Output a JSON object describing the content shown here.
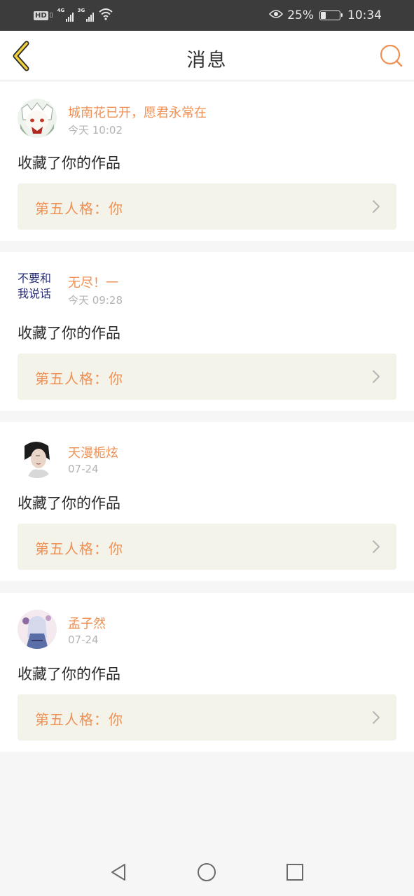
{
  "status_bar": {
    "hd_label": "HD",
    "net1": "4G",
    "net2": "3G",
    "battery_percent": "25%",
    "battery_level": 0.25,
    "time": "10:34"
  },
  "header": {
    "title": "消息",
    "back_icon": "chevron-left-icon",
    "search_icon": "search-icon"
  },
  "colors": {
    "accent": "#ef9154",
    "back_arrow": "#f0d23a",
    "work_bg": "#f4f3ea",
    "status_bar": "#3c3c3c"
  },
  "messages": [
    {
      "user": "城南花已开，愿君永常在",
      "time": "今天 10:02",
      "action": "收藏了你的作品",
      "work": "第五人格：你"
    },
    {
      "user": "无尽！一",
      "time": "今天 09:28",
      "action": "收藏了你的作品",
      "work": "第五人格：你",
      "avatar_text": [
        "不要和",
        "我说话"
      ]
    },
    {
      "user": "天漫栀炫",
      "time": "07-24",
      "action": "收藏了你的作品",
      "work": "第五人格：你"
    },
    {
      "user": "孟子然",
      "time": "07-24",
      "action": "收藏了你的作品",
      "work": "第五人格：你"
    }
  ],
  "system_nav": {
    "back_icon": "triangle-back-icon",
    "home_icon": "circle-home-icon",
    "recent_icon": "square-recents-icon"
  }
}
